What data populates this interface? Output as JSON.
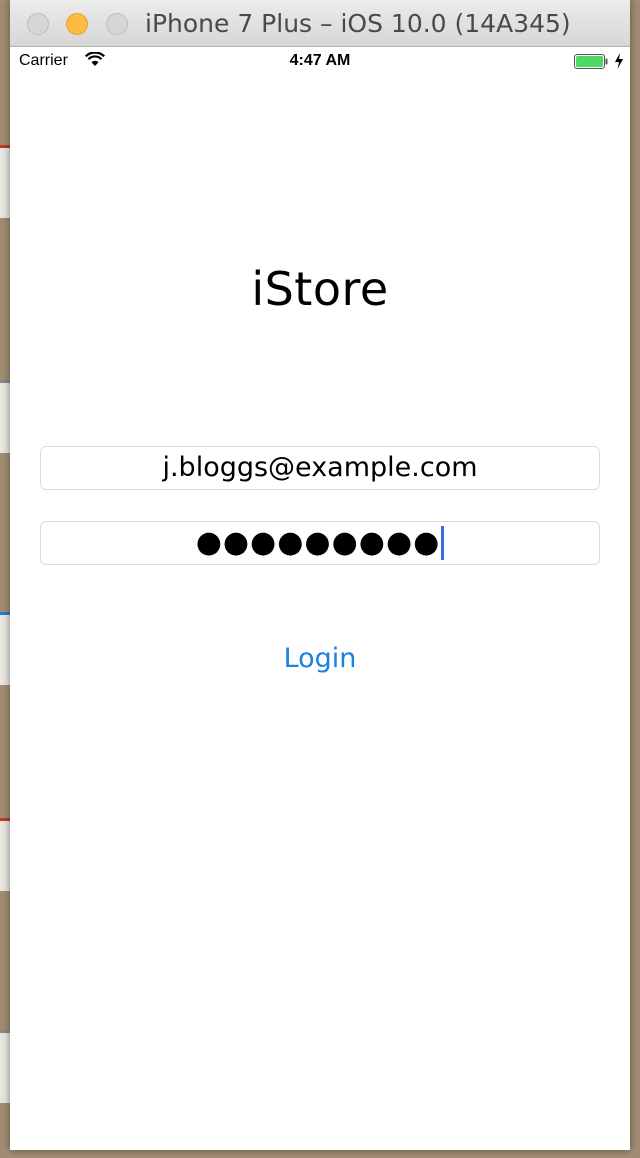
{
  "simulator": {
    "window_title": "iPhone 7 Plus – iOS 10.0 (14A345)"
  },
  "status_bar": {
    "carrier": "Carrier",
    "time": "4:47 AM",
    "battery_color": "#4cd964"
  },
  "app": {
    "title": "iStore",
    "email_field_value": "j.bloggs@example.com",
    "password_masked": "●●●●●●●●●",
    "login_button_label": "Login",
    "accent_color": "#1a82e6"
  }
}
